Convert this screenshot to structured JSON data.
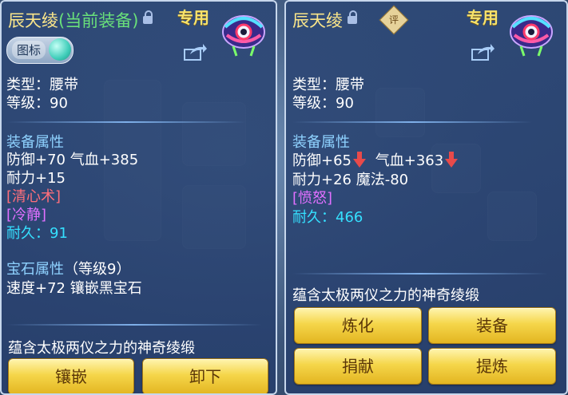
{
  "left_panel": {
    "title": "辰天绫",
    "title_current": "(当前装备)",
    "special_label": "专用",
    "toggle_label": "图标",
    "type_line": "类型：腰带",
    "level_line": "等级：90",
    "attr_header": "装备属性",
    "attr_line1": "防御+70 气血+385",
    "attr_line2": "耐力+15",
    "skill1": "[清心术]",
    "skill2": "[冷静]",
    "durability": "耐久：91",
    "gem_header": "宝石属性",
    "gem_level": "（等级9）",
    "gem_line": "速度+72 镶嵌黑宝石",
    "description": "蕴含太极两仪之力的神奇绫缎",
    "buttons": {
      "inlay": "镶嵌",
      "unequip": "卸下"
    }
  },
  "right_panel": {
    "title": "辰天绫",
    "rating_badge": "评",
    "special_label": "专用",
    "type_line": "类型：腰带",
    "level_line": "等级：90",
    "attr_header": "装备属性",
    "attr_def": "防御+65",
    "attr_hp": "气血+363",
    "attr_line2": "耐力+26 魔法-80",
    "skill1": "[愤怒]",
    "durability": "耐久：466",
    "description": "蕴含太极两仪之力的神奇绫缎",
    "buttons": {
      "refine": "炼化",
      "equip": "装备",
      "donate": "捐献",
      "extract": "提炼"
    },
    "down_arrow_color": "#e84a4a"
  },
  "colors": {
    "title": "#f9e58a",
    "current": "#69e07a",
    "section": "#8fd2ff",
    "skill_red": "#ff6f7b",
    "skill_purple": "#e070ff",
    "durability": "#35e0ff",
    "button_gold": "#f5d64a"
  }
}
